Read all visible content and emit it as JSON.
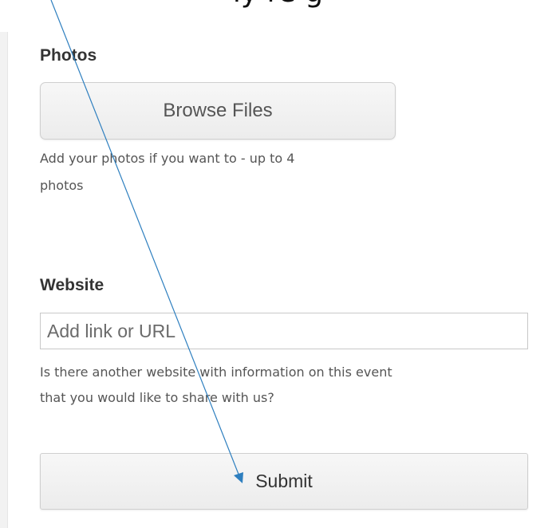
{
  "top_caption": "ly re     g",
  "photos": {
    "heading": "Photos",
    "browse_label": "Browse Files",
    "help_line1": "Add your photos if you want to - up to 4",
    "help_line2": "photos"
  },
  "website": {
    "heading": "Website",
    "placeholder": "Add link or URL",
    "value": "",
    "help_line1": "Is there another website with information on this event",
    "help_line2": "that you would like to share with us?"
  },
  "submit": {
    "label": "Submit"
  },
  "colors": {
    "annotation_arrow": "#2e7fbf",
    "button_background": "#f0f0f0",
    "text": "#333333"
  },
  "icons": {
    "annotation": "arrow-pointer-icon"
  }
}
